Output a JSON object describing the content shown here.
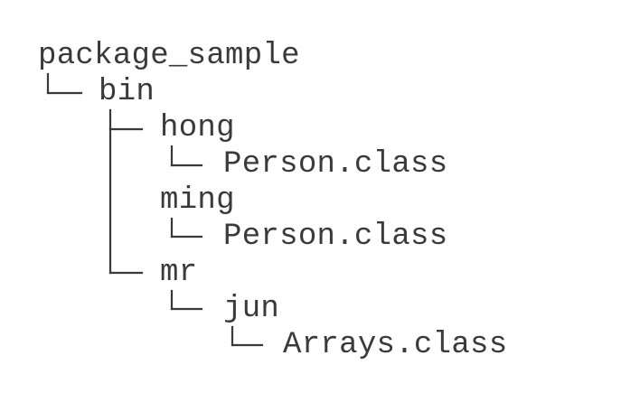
{
  "tree": {
    "root": "package_sample",
    "bin": "bin",
    "hong": "hong",
    "hong_file": "Person.class",
    "ming": "ming",
    "ming_file": "Person.class",
    "mr": "mr",
    "jun": "jun",
    "jun_file": "Arrays.class"
  },
  "colors": {
    "text": "#3a3a3a",
    "background": "#ffffff"
  }
}
